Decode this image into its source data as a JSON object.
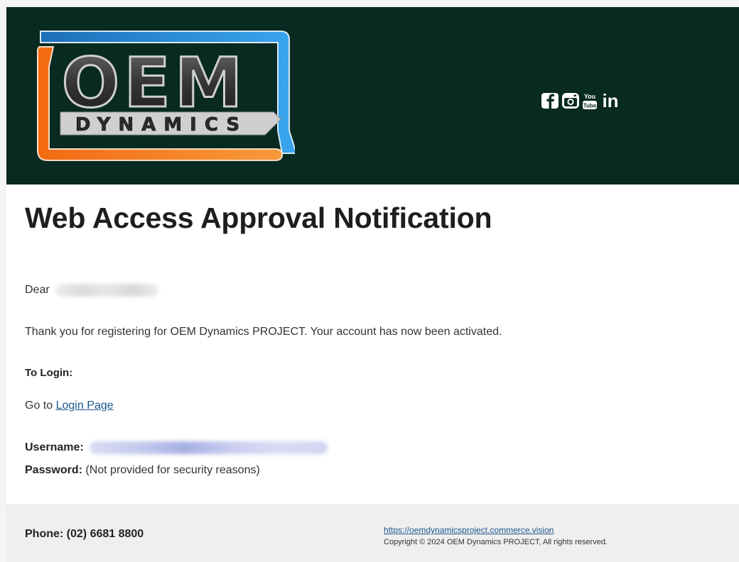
{
  "header": {
    "logo": {
      "line1": "OEM",
      "line2": "DYNAMICS"
    },
    "socials": [
      {
        "icon": "facebook-icon"
      },
      {
        "icon": "instagram-icon"
      },
      {
        "icon": "youtube-icon",
        "text_top": "You",
        "text_bottom": "Tube"
      },
      {
        "icon": "linkedin-icon",
        "text": "in"
      }
    ]
  },
  "email": {
    "title": "Web Access Approval Notification",
    "greeting": "Dear",
    "message": "Thank you for registering for OEM Dynamics PROJECT. Your account has now been activated.",
    "login_heading": "To Login:",
    "go_to": "Go to",
    "login_link": "Login Page",
    "username_label": "Username:",
    "password_label": "Password:",
    "password_value": "(Not provided for security reasons)"
  },
  "footer": {
    "phone": "Phone: (02) 6681 8800",
    "website": "https://oemdynamicsproject.commerce.vision",
    "copyright": "Copyright © 2024 OEM Dynamics PROJECT, All rights reserved."
  },
  "colors": {
    "header_bg": "#082a20",
    "logo_orange": "#f07a1a",
    "logo_blue": "#2b8fd8",
    "link": "#20588f",
    "footer_bg": "#efefef"
  }
}
